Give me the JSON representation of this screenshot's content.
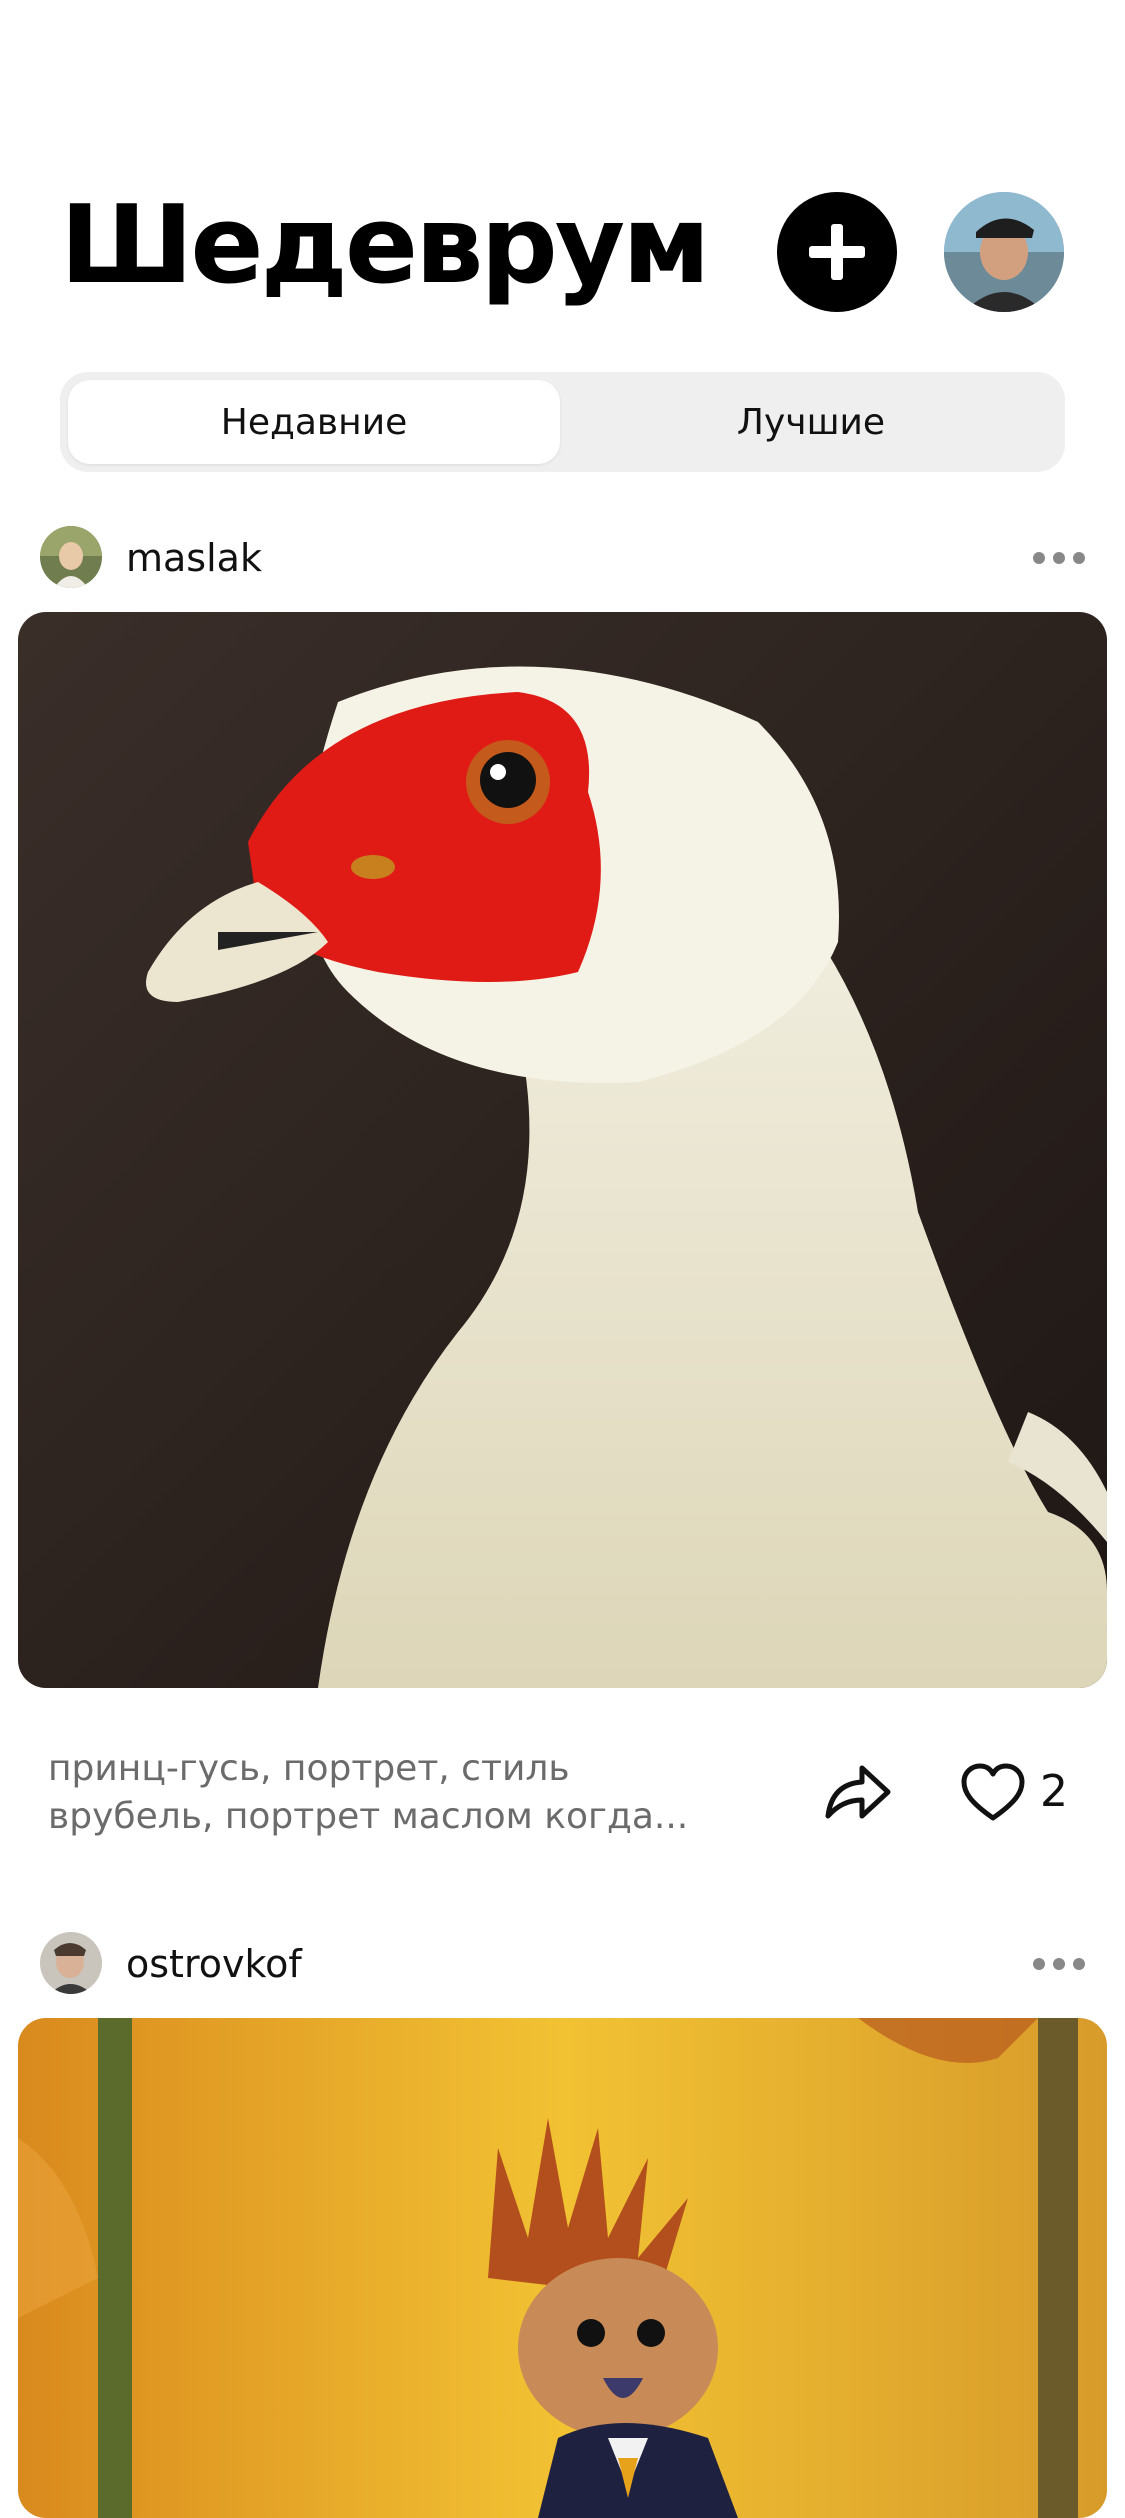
{
  "header": {
    "title": "Шедеврум"
  },
  "tabs": [
    {
      "label": "Недавние",
      "active": true
    },
    {
      "label": "Лучшие",
      "active": false
    }
  ],
  "posts": [
    {
      "username": "maslak",
      "image": "painting-white-goose-red-face",
      "caption_line1": "принц-гусь, портрет, стиль",
      "caption_line2": "врубель, портрет маслом когда...",
      "likes": "2"
    },
    {
      "username": "ostrovkof",
      "image": "painting-hedgehog-autumn-forest"
    }
  ],
  "icons": {
    "create": "plus-icon",
    "share": "share-arrow-icon",
    "like": "heart-icon",
    "more": "more-dots-icon"
  }
}
